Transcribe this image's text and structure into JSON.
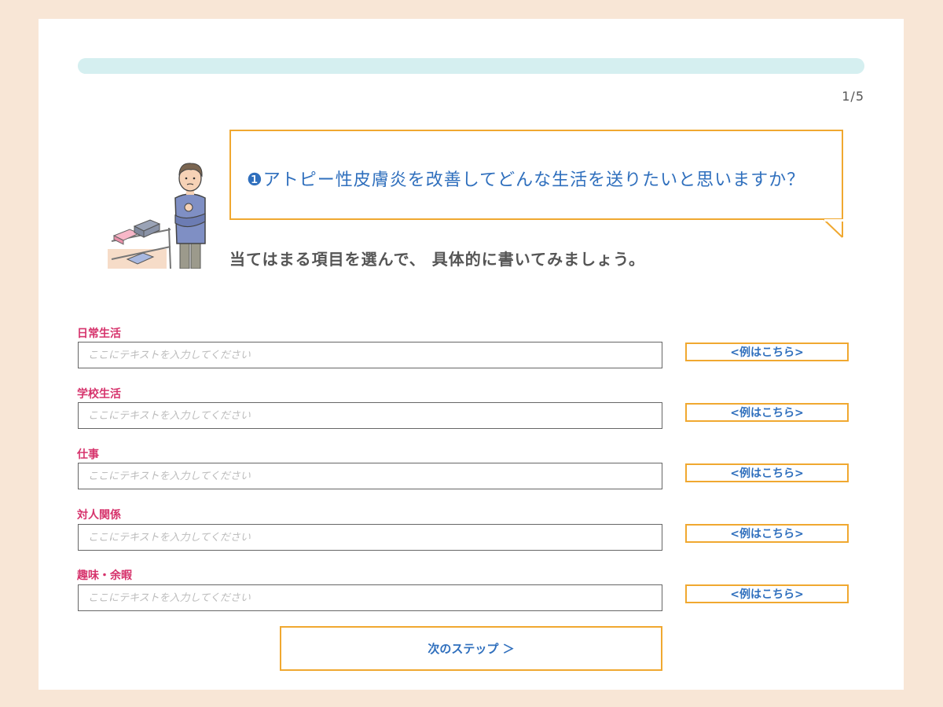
{
  "progress": {
    "fraction": 0.2,
    "counter": "1/5"
  },
  "question": {
    "text": "❶アトピー性皮膚炎を改善してどんな生活を送りたいと思いますか？"
  },
  "instruction": "当てはまる項目を選んで、 具体的に書いてみましょう。",
  "fields": [
    {
      "label": "日常生活",
      "placeholder": "ここにテキストを入力してください",
      "value": "",
      "example_label": "<例はこちら>"
    },
    {
      "label": "学校生活",
      "placeholder": "ここにテキストを入力してください",
      "value": "",
      "example_label": "<例はこちら>"
    },
    {
      "label": "仕事",
      "placeholder": "ここにテキストを入力してください",
      "value": "",
      "example_label": "<例はこちら>"
    },
    {
      "label": "対人関係",
      "placeholder": "ここにテキストを入力してください",
      "value": "",
      "example_label": "<例はこちら>"
    },
    {
      "label": "趣味・余暇",
      "placeholder": "ここにテキストを入力してください",
      "value": "",
      "example_label": "<例はこちら>"
    }
  ],
  "next_button": {
    "label": "次のステップ ＞"
  },
  "colors": {
    "accent_orange": "#f0a830",
    "link_blue": "#2f6fbd",
    "label_pink": "#d6336c",
    "progress_track": "#d5eff0",
    "page_background": "#f8e6d6"
  },
  "illustration": {
    "icon": "thinking-person-with-clothes-rack-illustration"
  }
}
